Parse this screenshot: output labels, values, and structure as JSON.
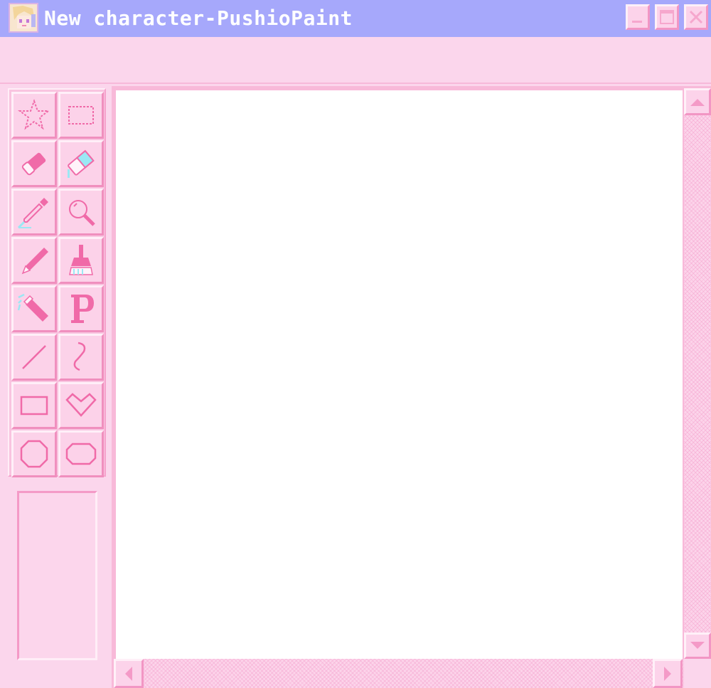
{
  "window": {
    "title": "New character-PushioPaint",
    "controls": [
      "minimize",
      "maximize",
      "close"
    ]
  },
  "toolbox": {
    "tools": [
      {
        "name": "star-select",
        "icon": "star-select-icon"
      },
      {
        "name": "rect-select",
        "icon": "rect-select-icon"
      },
      {
        "name": "eraser",
        "icon": "eraser-icon"
      },
      {
        "name": "color-eraser",
        "icon": "color-eraser-icon"
      },
      {
        "name": "eyedropper",
        "icon": "eyedropper-icon"
      },
      {
        "name": "magnifier",
        "icon": "magnifier-icon"
      },
      {
        "name": "pencil",
        "icon": "pencil-icon"
      },
      {
        "name": "brush",
        "icon": "brush-icon"
      },
      {
        "name": "airbrush",
        "icon": "airbrush-icon"
      },
      {
        "name": "text",
        "icon": "text-p-icon",
        "glyph": "P"
      },
      {
        "name": "line",
        "icon": "line-icon"
      },
      {
        "name": "curve",
        "icon": "curve-icon"
      },
      {
        "name": "rectangle",
        "icon": "rectangle-icon"
      },
      {
        "name": "heart",
        "icon": "heart-icon"
      },
      {
        "name": "octagon",
        "icon": "octagon-icon"
      },
      {
        "name": "rounded-octagon",
        "icon": "rounded-octagon-icon"
      }
    ]
  },
  "colors": {
    "titlebar": "#a6a8fb",
    "background": "#fbd6ec",
    "accent": "#f06aa8",
    "highlight": "#9be8f4",
    "canvas": "#ffffff"
  }
}
